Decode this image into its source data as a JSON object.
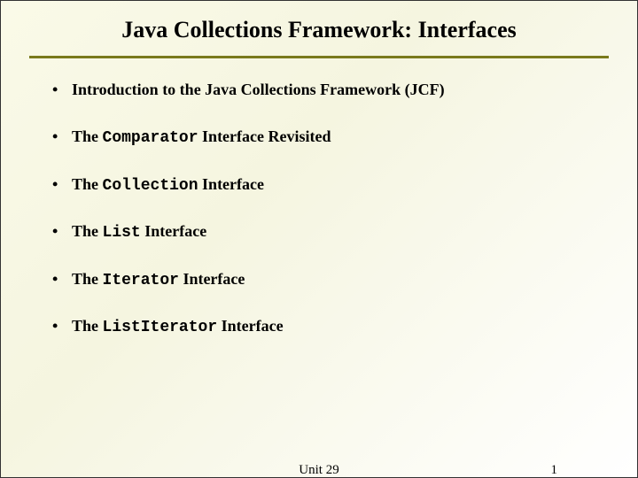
{
  "title": "Java Collections Framework: Interfaces",
  "bullets": [
    {
      "pre": "Introduction to the Java Collections Framework (JCF)",
      "code": "",
      "post": ""
    },
    {
      "pre": "The ",
      "code": "Comparator",
      "post": " Interface Revisited"
    },
    {
      "pre": "The ",
      "code": "Collection",
      "post": " Interface"
    },
    {
      "pre": "The ",
      "code": "List",
      "post": " Interface"
    },
    {
      "pre": "The ",
      "code": "Iterator",
      "post": " Interface"
    },
    {
      "pre": "The ",
      "code": "ListIterator",
      "post": " Interface"
    }
  ],
  "footer": {
    "unit": "Unit 29",
    "page": "1"
  }
}
